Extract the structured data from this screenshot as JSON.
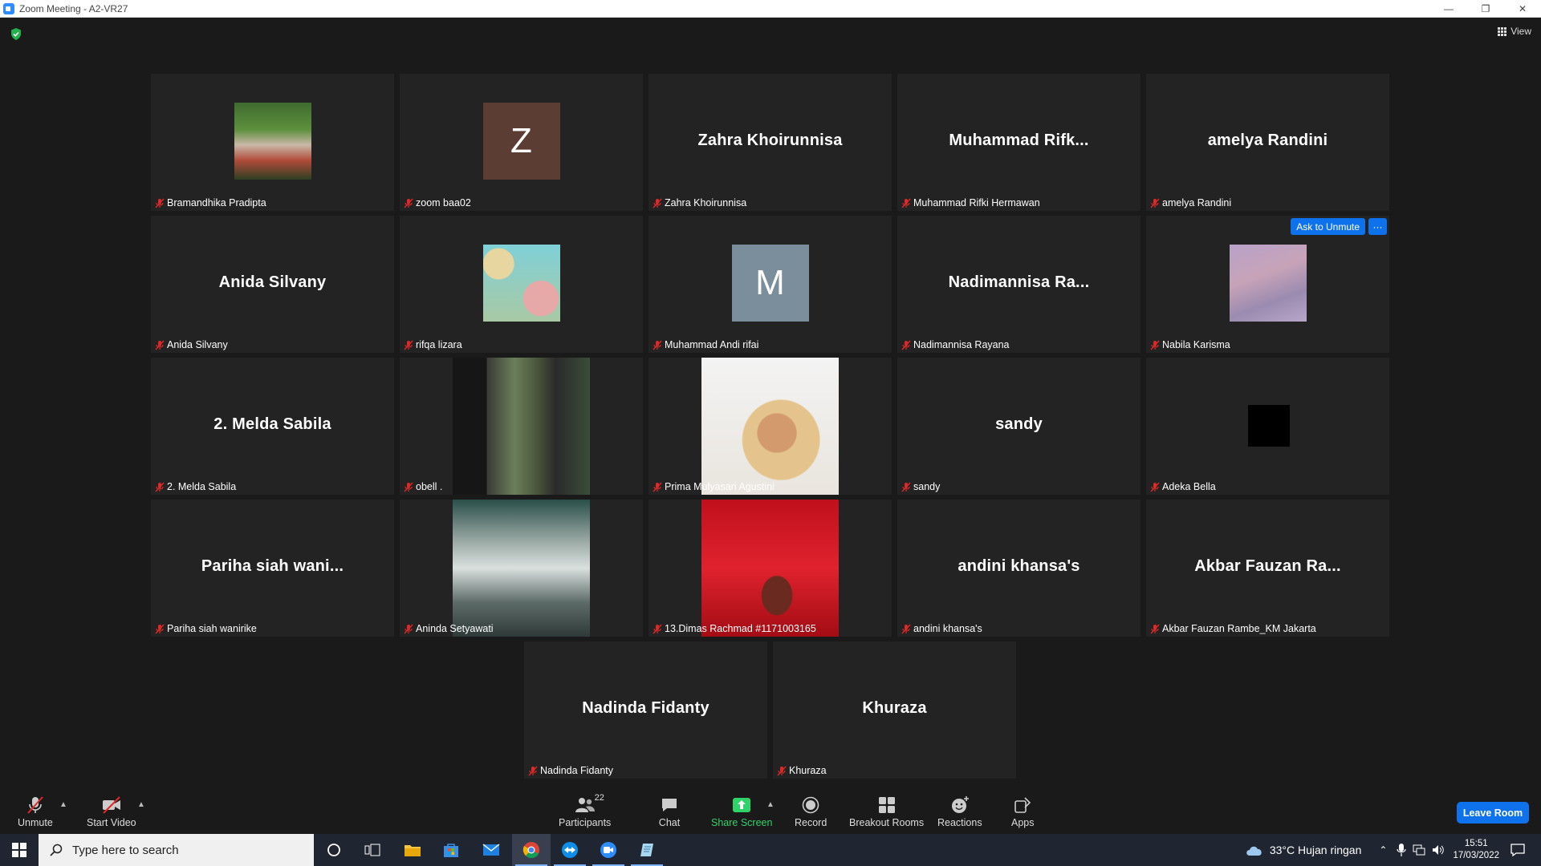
{
  "window": {
    "title": "Zoom Meeting - A2-VR27"
  },
  "header": {
    "view_label": "View"
  },
  "tiles": [
    {
      "name": "Bramandhika Pradipta",
      "display": "photo",
      "row": 0,
      "col": 0
    },
    {
      "name": "zoom baa02",
      "display": "letter",
      "letter": "Z",
      "avatar_color": "#5c3d33",
      "row": 0,
      "col": 1
    },
    {
      "name": "Zahra Khoirunnisa",
      "display": "text",
      "big": "Zahra Khoirunnisa",
      "row": 0,
      "col": 2
    },
    {
      "name": "Muhammad Rifki Hermawan",
      "display": "text",
      "big": "Muhammad  Rifk...",
      "row": 0,
      "col": 3
    },
    {
      "name": "amelya Randini",
      "display": "text",
      "big": "amelya Randini",
      "row": 0,
      "col": 4
    },
    {
      "name": "Anida Silvany",
      "display": "text",
      "big": "Anida Silvany",
      "row": 1,
      "col": 0
    },
    {
      "name": "rifqa lizara",
      "display": "photo",
      "row": 1,
      "col": 1
    },
    {
      "name": "Muhammad Andi rifai",
      "display": "letter",
      "letter": "M",
      "avatar_color": "#7b8e9c",
      "row": 1,
      "col": 2
    },
    {
      "name": "Nadimannisa Rayana",
      "display": "text",
      "big": "Nadimannisa  Ra...",
      "row": 1,
      "col": 3
    },
    {
      "name": "Nabila Karisma",
      "display": "photo",
      "row": 1,
      "col": 4
    },
    {
      "name": "2. Melda Sabila",
      "display": "text",
      "big": "2. Melda Sabila",
      "row": 2,
      "col": 0
    },
    {
      "name": "obell .",
      "display": "video",
      "row": 2,
      "col": 1
    },
    {
      "name": "Prima Mulyasari Agustini",
      "display": "video",
      "row": 2,
      "col": 2
    },
    {
      "name": "sandy",
      "display": "text",
      "big": "sandy",
      "row": 2,
      "col": 3
    },
    {
      "name": "Adeka Bella",
      "display": "black",
      "row": 2,
      "col": 4
    },
    {
      "name": "Pariha siah wanirike",
      "display": "text",
      "big": "Pariha  siah  wani...",
      "row": 3,
      "col": 0
    },
    {
      "name": "Aninda Setyawati",
      "display": "video",
      "row": 3,
      "col": 1
    },
    {
      "name": "13.Dimas Rachmad #1171003165",
      "display": "video",
      "row": 3,
      "col": 2
    },
    {
      "name": "andini khansa's",
      "display": "text",
      "big": "andini khansa's",
      "row": 3,
      "col": 3
    },
    {
      "name": "Akbar Fauzan Rambe_KM Jakarta",
      "display": "text",
      "big": "Akbar  Fauzan  Ra...",
      "row": 3,
      "col": 4
    },
    {
      "name": "Nadinda Fidanty",
      "display": "text",
      "big": "Nadinda Fidanty",
      "row": 4,
      "col": 0
    },
    {
      "name": "Khuraza",
      "display": "text",
      "big": "Khuraza",
      "row": 4,
      "col": 1
    }
  ],
  "hover_controls": {
    "ask_to_unmute": "Ask to Unmute",
    "more": "···"
  },
  "toolbar": {
    "unmute": "Unmute",
    "start_video": "Start Video",
    "participants": "Participants",
    "participants_count": "22",
    "chat": "Chat",
    "share_screen": "Share Screen",
    "record": "Record",
    "breakout_rooms": "Breakout Rooms",
    "reactions": "Reactions",
    "apps": "Apps",
    "leave_room": "Leave Room"
  },
  "taskbar": {
    "search_placeholder": "Type here to search",
    "weather": "33°C  Hujan ringan",
    "time": "15:51",
    "date": "17/03/2022"
  },
  "colors": {
    "accent": "#0e72ed",
    "share_green": "#2fd36a",
    "muted_red": "#e02828",
    "tile_bg": "#232323"
  }
}
